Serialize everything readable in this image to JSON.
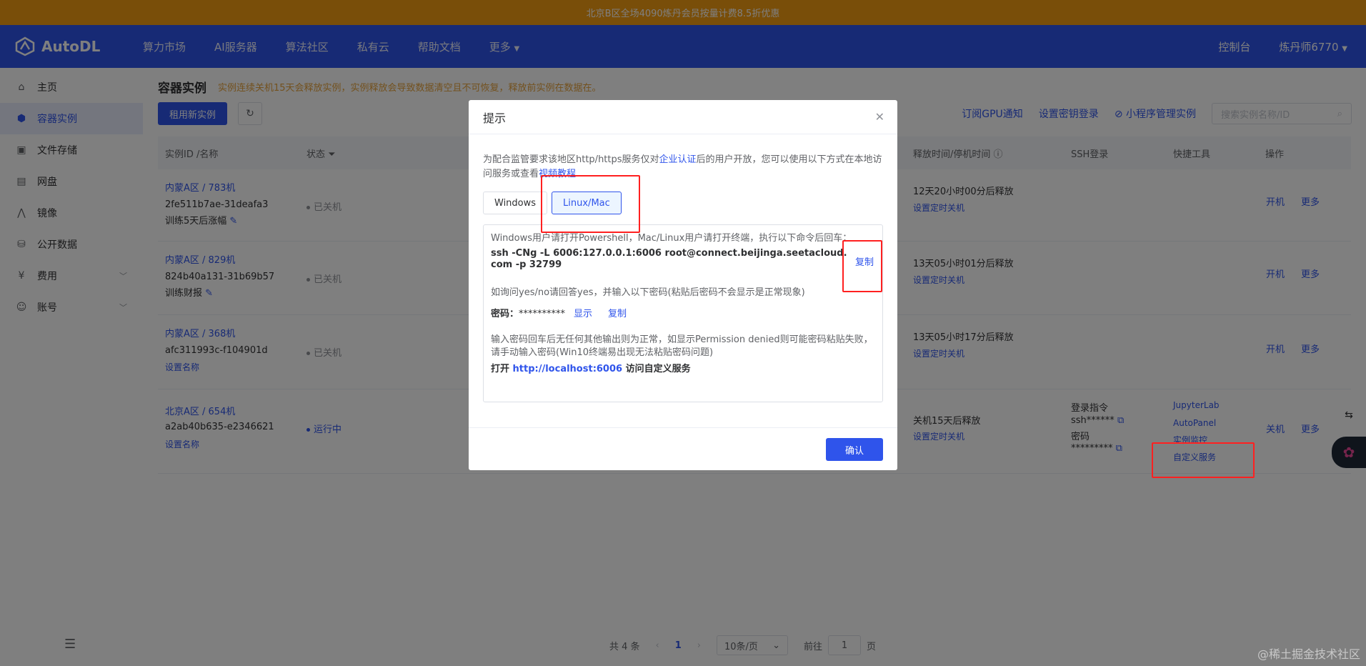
{
  "banner": {
    "text": "北京B区全场4090炼丹会员按量计费8.5折优惠"
  },
  "nav": {
    "brand": "AutoDL",
    "items": [
      "算力市场",
      "AI服务器",
      "算法社区",
      "私有云",
      "帮助文档",
      "更多"
    ],
    "console": "控制台",
    "user": "炼丹师6770"
  },
  "sidebar": {
    "items": [
      {
        "label": "主页",
        "icon": "home-icon"
      },
      {
        "label": "容器实例",
        "icon": "container-icon"
      },
      {
        "label": "文件存储",
        "icon": "storage-icon"
      },
      {
        "label": "网盘",
        "icon": "disk-icon"
      },
      {
        "label": "镜像",
        "icon": "image-icon"
      },
      {
        "label": "公开数据",
        "icon": "database-icon"
      },
      {
        "label": "费用",
        "icon": "yen-icon"
      },
      {
        "label": "账号",
        "icon": "user-icon"
      }
    ]
  },
  "page": {
    "title": "容器实例",
    "warning": "实例连续关机15天会释放实例，实例释放会导致数据清空且不可恢复，释放前实例在数据在。",
    "rent_button": "租用新实例",
    "gpu_notify": "订阅GPU通知",
    "ssh_key": "设置密钥登录",
    "mini_program": "小程序管理实例",
    "search_placeholder": "搜索实例名称/ID"
  },
  "table": {
    "headers": {
      "id": "实例ID /名称",
      "status": "状态",
      "release": "释放时间/停机时间",
      "ssh": "SSH登录",
      "tools": "快捷工具",
      "ops": "操作"
    },
    "rows": [
      {
        "region": "内蒙A区 / 783机",
        "id": "2fe511b7ae-31deafa3",
        "name": "训练5天后涨幅",
        "status": "已关机",
        "release": "12天20小时00分后释放",
        "schedule": "设置定时关机",
        "power": "开机",
        "more": "更多"
      },
      {
        "region": "内蒙A区 / 829机",
        "id": "824b40a131-31b69b57",
        "name": "训练财报",
        "status": "已关机",
        "release": "13天05小时01分后释放",
        "schedule": "设置定时关机",
        "power": "开机",
        "more": "更多"
      },
      {
        "region": "内蒙A区 / 368机",
        "id": "afc311993c-f104901d",
        "name": "设置名称",
        "status": "已关机",
        "release": "13天05小时17分后释放",
        "schedule": "设置定时关机",
        "power": "开机",
        "more": "更多"
      },
      {
        "region": "北京A区 / 654机",
        "id": "a2ab40b635-e2346621",
        "name": "设置名称",
        "status": "运行中",
        "release": "关机15天后释放",
        "schedule": "设置定时关机",
        "power": "关机",
        "more": "更多",
        "ssh_cmd_label": "登录指令",
        "ssh_cmd": "ssh******",
        "ssh_pwd_label": "密码",
        "ssh_pwd": "*********",
        "tools": [
          "JupyterLab",
          "AutoPanel",
          "实例监控",
          "自定义服务"
        ]
      }
    ]
  },
  "pager": {
    "total": "共 4 条",
    "current": "1",
    "size": "10条/页",
    "goto": "前往",
    "goto_value": "1",
    "page_unit": "页"
  },
  "modal": {
    "title": "提示",
    "intro_pre": "为配合监管要求该地区http/https服务仅对",
    "intro_link": "企业认证",
    "intro_mid": "后的用户开放，您可以使用以下方式在本地访问服务或查看",
    "intro_link2": "视频教程",
    "tabs": [
      "Windows",
      "Linux/Mac"
    ],
    "instruction": "Windows用户请打开Powershell，Mac/Linux用户请打开终端，执行以下命令后回车：",
    "command": "ssh -CNg -L 6006:127.0.0.1:6006 root@connect.beijinga.seetacloud.com -p 32799",
    "copy": "复制",
    "yes_hint": "如询问yes/no请回答yes，并输入以下密码(粘贴后密码不会显示是正常现象)",
    "pwd_label": "密码：",
    "pwd_value": "**********",
    "show": "显示",
    "copy2": "复制",
    "note": "输入密码回车后无任何其他输出则为正常，如显示Permission denied则可能密码粘贴失败，请手动输入密码(Win10终端易出现无法粘贴密码问题)",
    "open_pre": "打开",
    "open_url": "http://localhost:6006",
    "open_post": "访问自定义服务",
    "ok": "确认"
  },
  "watermark": "@稀土掘金技术社区"
}
